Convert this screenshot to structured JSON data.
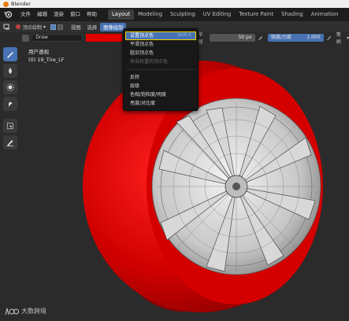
{
  "app": {
    "title": "Blender"
  },
  "topbar": {
    "menus": [
      "文件",
      "编辑",
      "渲染",
      "窗口",
      "帮助"
    ],
    "workspace_tabs": [
      {
        "label": "Layout",
        "active": true
      },
      {
        "label": "Modeling",
        "active": false
      },
      {
        "label": "Sculpting",
        "active": false
      },
      {
        "label": "UV Editing",
        "active": false
      },
      {
        "label": "Texture Paint",
        "active": false
      },
      {
        "label": "Shading",
        "active": false
      },
      {
        "label": "Animation",
        "active": false
      }
    ]
  },
  "header": {
    "mode_label": "顶点绘制",
    "menus": [
      "视图",
      "选择",
      "图像绘制"
    ]
  },
  "tool_settings": {
    "brush_name": "Draw",
    "paint_color": "#e00000",
    "radius_label": "半径",
    "radius_value": "50 px",
    "strength_label": "强度/力度",
    "strength_value": "1.000",
    "brush_label": "笔刷"
  },
  "viewport": {
    "view_name": "用户透视",
    "object_name": "(0) 19_Tire_LF"
  },
  "dropdown": {
    "items": [
      {
        "label": "设置顶点色",
        "shortcut": "Shift K",
        "state": "highlight"
      },
      {
        "label": "平滑顶点色",
        "state": "normal"
      },
      {
        "label": "脏旧顶点色",
        "state": "normal"
      },
      {
        "label": "来自权重的顶点色",
        "state": "disabled"
      },
      {
        "sep": true
      },
      {
        "label": "反转",
        "state": "normal"
      },
      {
        "label": "层级",
        "state": "normal"
      },
      {
        "label": "色相/饱和度/明度",
        "state": "normal"
      },
      {
        "label": "亮度/对比度",
        "state": "normal"
      }
    ]
  },
  "watermark": {
    "text": "大数跨境"
  },
  "colors": {
    "accent": "#4772b3",
    "highlight_outline": "#f1d000",
    "tire": "#d10000"
  }
}
